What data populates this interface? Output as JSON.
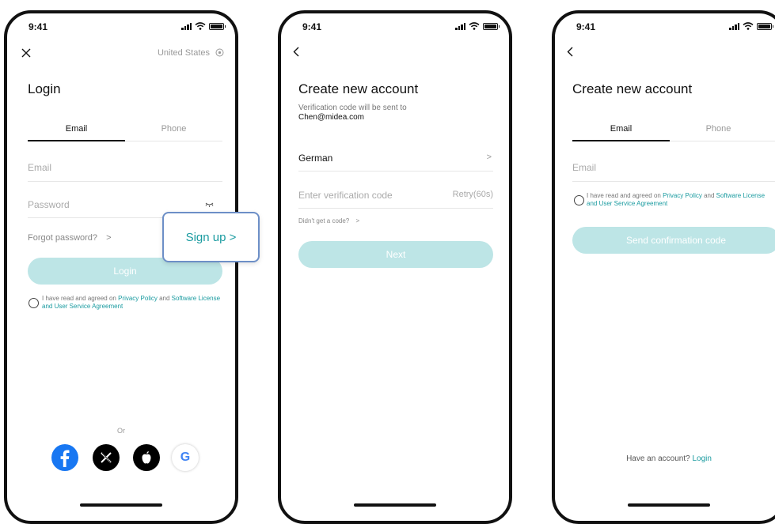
{
  "status": {
    "time": "9:41"
  },
  "login_screen": {
    "close_icon": "close-icon",
    "region_label": "United States",
    "region_icon": "location-pin-icon",
    "title": "Login",
    "tabs": [
      {
        "label": "Email",
        "active": true
      },
      {
        "label": "Phone",
        "active": false
      }
    ],
    "email_placeholder": "Email",
    "password_placeholder": "Password",
    "password_icon": "eye-closed-icon",
    "forgot_label": "Forgot password?",
    "forgot_chevron": ">",
    "signup_label": "Sign up >",
    "login_button": "Login",
    "agreement": {
      "prefix": "I have read and agreed on ",
      "link1": "Privacy Policy",
      "mid": " and ",
      "link2": "Software License and User Service Agreement"
    },
    "or_label": "Or",
    "social": [
      "facebook-icon",
      "x-icon",
      "apple-icon",
      "google-icon"
    ]
  },
  "verify_screen": {
    "back_icon": "chevron-left-icon",
    "title": "Create new account",
    "subtitle_line1": "Verification code will be sent to",
    "subtitle_line2": "Chen@midea.com",
    "language": "German",
    "language_chevron": ">",
    "code_placeholder": "Enter verification code",
    "retry_label": "Retry(60s)",
    "no_code_label": "Didn't get a code?",
    "no_code_chevron": ">",
    "next_button": "Next"
  },
  "signup_screen": {
    "back_icon": "chevron-left-icon",
    "title": "Create new account",
    "tabs": [
      {
        "label": "Email",
        "active": true
      },
      {
        "label": "Phone",
        "active": false
      }
    ],
    "email_placeholder": "Email",
    "agreement": {
      "prefix": "I have read and agreed on ",
      "link1": "Privacy Policy",
      "mid": " and ",
      "link2": "Software License and User Service Agreement"
    },
    "send_button": "Send confirmation code",
    "have_account": "Have an account?",
    "login_link": "Login"
  },
  "colors": {
    "accent": "#1a9ba0",
    "button_disabled": "#bde5e6",
    "popout_border": "#6d8fc7"
  }
}
